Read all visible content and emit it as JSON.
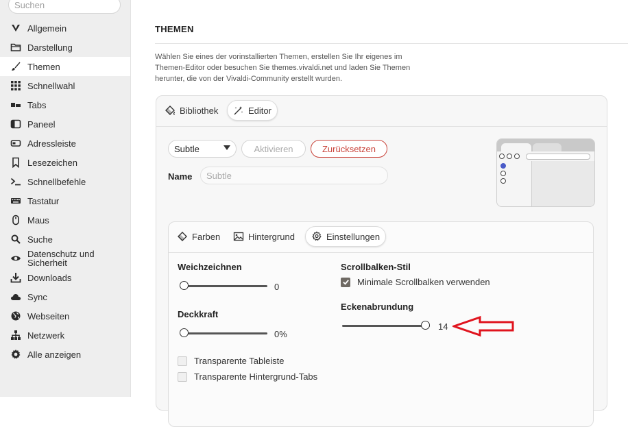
{
  "sidebar": {
    "search_placeholder": "Suchen",
    "items": [
      {
        "label": "Allgemein",
        "icon": "vivaldi-v-icon"
      },
      {
        "label": "Darstellung",
        "icon": "folder-icon"
      },
      {
        "label": "Themen",
        "icon": "brush-icon",
        "active": true
      },
      {
        "label": "Schnellwahl",
        "icon": "grid-icon"
      },
      {
        "label": "Tabs",
        "icon": "tabs-icon"
      },
      {
        "label": "Paneel",
        "icon": "panel-icon"
      },
      {
        "label": "Adressleiste",
        "icon": "address-bar-icon"
      },
      {
        "label": "Lesezeichen",
        "icon": "bookmark-icon"
      },
      {
        "label": "Schnellbefehle",
        "icon": "command-icon"
      },
      {
        "label": "Tastatur",
        "icon": "keyboard-icon"
      },
      {
        "label": "Maus",
        "icon": "mouse-icon"
      },
      {
        "label": "Suche",
        "icon": "magnifier-icon"
      },
      {
        "label": "Datenschutz und Sicherheit",
        "icon": "eye-icon"
      },
      {
        "label": "Downloads",
        "icon": "download-icon"
      },
      {
        "label": "Sync",
        "icon": "cloud-icon"
      },
      {
        "label": "Webseiten",
        "icon": "globe-icon"
      },
      {
        "label": "Netzwerk",
        "icon": "network-icon"
      },
      {
        "label": "Alle anzeigen",
        "icon": "gear-icon"
      }
    ]
  },
  "main": {
    "title": "THEMEN",
    "description": "Wählen Sie eines der vorinstallierten Themen, erstellen Sie Ihr eigenes im Themen-Editor oder besuchen Sie themes.vivaldi.net und laden Sie Themen herunter, die von der Vivaldi-Community erstellt wurden.",
    "tabs": [
      {
        "label": "Bibliothek",
        "icon": "paint-bucket-icon"
      },
      {
        "label": "Editor",
        "icon": "wand-icon",
        "active": true
      }
    ],
    "theme_select": "Subtle",
    "activate_label": "Aktivieren",
    "reset_label": "Zurücksetzen",
    "name_label": "Name",
    "name_placeholder": "Subtle",
    "editor": {
      "tabs": [
        {
          "label": "Farben",
          "icon": "paint-bucket-icon"
        },
        {
          "label": "Hintergrund",
          "icon": "image-icon"
        },
        {
          "label": "Einstellungen",
          "icon": "gear-icon",
          "active": true
        }
      ],
      "blur": {
        "label": "Weichzeichnen",
        "value": "0",
        "fraction": 0.0
      },
      "opacity": {
        "label": "Deckkraft",
        "value": "0%",
        "fraction": 0.0
      },
      "scrollbar": {
        "label": "Scrollbalken-Stil",
        "checkbox_label": "Minimale Scrollbalken verwenden",
        "checked": true
      },
      "corner": {
        "label": "Eckenabrundung",
        "value": "14",
        "fraction": 1.0
      },
      "transparent_tabbar": {
        "label": "Transparente Tableiste",
        "checked": false
      },
      "transparent_bg_tabs": {
        "label": "Transparente Hintergrund-Tabs",
        "checked": false
      }
    }
  },
  "colors": {
    "accent_red": "#c9433a",
    "arrow_red": "#e0141e",
    "checkbox": "#6f6a64"
  }
}
